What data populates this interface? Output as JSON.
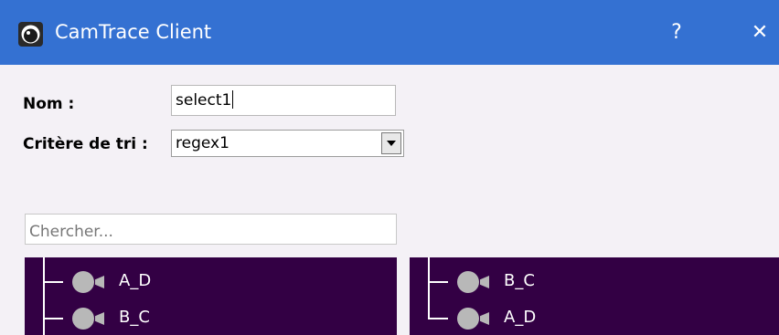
{
  "window": {
    "title": "CamTrace Client",
    "help_label": "?",
    "close_label": "✕",
    "icon": "camtrace-eye-icon"
  },
  "form": {
    "nom_label": "Nom :",
    "nom_value": "select1",
    "critere_label": "Critère de tri :",
    "critere_value": "regex1"
  },
  "search": {
    "placeholder": "Chercher...",
    "value": ""
  },
  "left_list": {
    "items": [
      {
        "label": "A_D",
        "icon": "camera-icon"
      },
      {
        "label": "B_C",
        "icon": "camera-icon"
      }
    ]
  },
  "right_list": {
    "items": [
      {
        "label": "B_C",
        "icon": "camera-icon"
      },
      {
        "label": "A_D",
        "icon": "camera-icon"
      }
    ]
  },
  "colors": {
    "titlebar": "#3471d2",
    "panel_bg": "#330044",
    "window_bg": "#f4f1f6",
    "camera_icon": "#b8b8b8"
  }
}
